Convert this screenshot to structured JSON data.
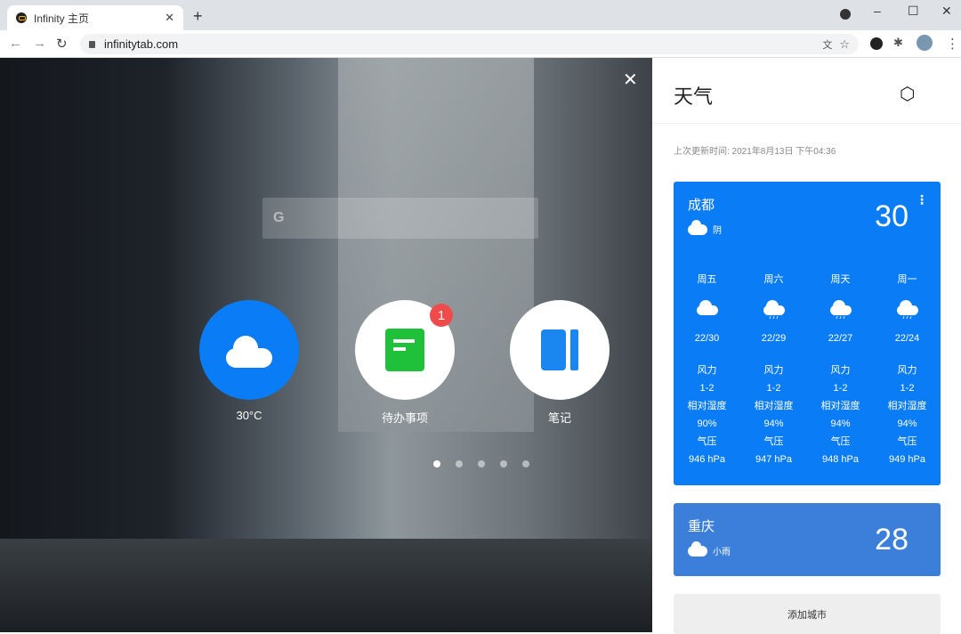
{
  "browser": {
    "tab_title": "Infinity 主页",
    "url": "infinitytab.com"
  },
  "apps": [
    {
      "label": "30°C",
      "icon": "cloud-icon",
      "color": "#0a7cf5"
    },
    {
      "label": "待办事项",
      "icon": "todo-icon",
      "badge": "1",
      "color": "#1fc13a"
    },
    {
      "label": "笔记",
      "icon": "notes-icon",
      "color": "#1a86f0"
    }
  ],
  "pager": {
    "pages": 5,
    "current": 1
  },
  "weather": {
    "title": "天气",
    "updated": "上次更新时间: 2021年8月13日 下午04:36",
    "cities": [
      {
        "name": "成都",
        "condition": "阴",
        "temp": "30",
        "forecast": [
          {
            "day": "周五",
            "range": "22/30",
            "wind_label": "风力",
            "wind": "1-2",
            "hum_label": "相对湿度",
            "hum": "90%",
            "pres_label": "气压",
            "pres": "946 hPa"
          },
          {
            "day": "周六",
            "range": "22/29",
            "wind_label": "风力",
            "wind": "1-2",
            "hum_label": "相对湿度",
            "hum": "94%",
            "pres_label": "气压",
            "pres": "947 hPa"
          },
          {
            "day": "周天",
            "range": "22/27",
            "wind_label": "风力",
            "wind": "1-2",
            "hum_label": "相对湿度",
            "hum": "94%",
            "pres_label": "气压",
            "pres": "948 hPa"
          },
          {
            "day": "周一",
            "range": "22/24",
            "wind_label": "风力",
            "wind": "1-2",
            "hum_label": "相对湿度",
            "hum": "94%",
            "pres_label": "气压",
            "pres": "949 hPa"
          }
        ]
      },
      {
        "name": "重庆",
        "condition": "小雨",
        "temp": "28"
      }
    ],
    "add_city": "添加城市"
  }
}
